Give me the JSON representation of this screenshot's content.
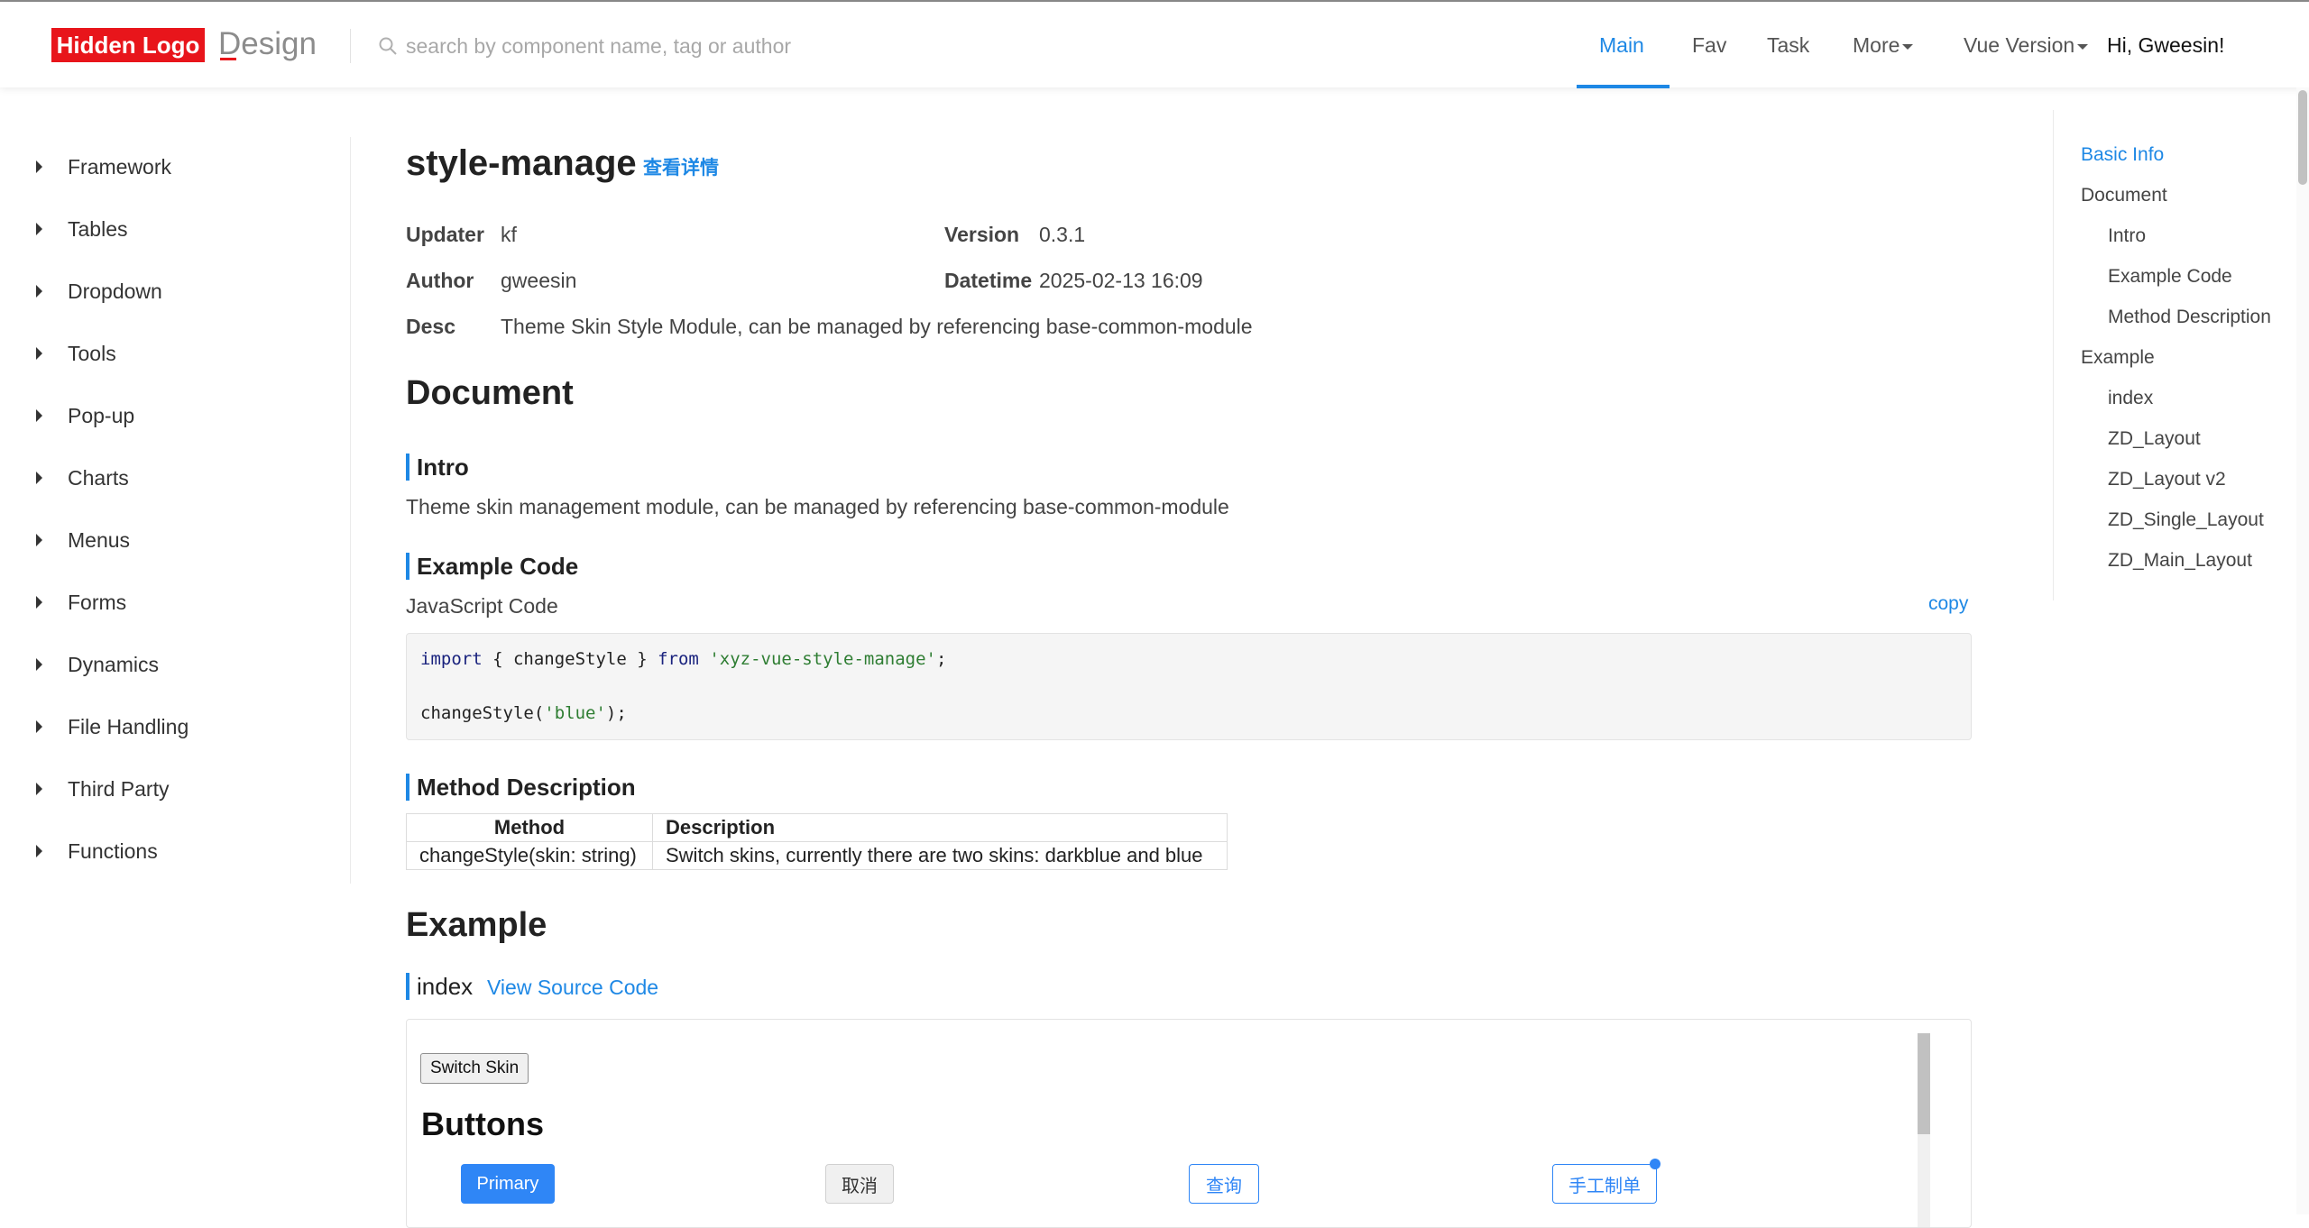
{
  "header": {
    "logo_text": "Hidden Logo",
    "brand_suffix": "Design",
    "search_placeholder": "search by component name, tag or author",
    "nav": [
      "Main",
      "Fav",
      "Task",
      "More",
      "Vue Version"
    ],
    "greeting": "Hi, Gweesin!",
    "accent_color": "#1e88e5",
    "logo_color": "#e8151b"
  },
  "sidebar": {
    "items": [
      "Framework",
      "Tables",
      "Dropdown",
      "Tools",
      "Pop-up",
      "Charts",
      "Menus",
      "Forms",
      "Dynamics",
      "File Handling",
      "Third Party",
      "Functions"
    ]
  },
  "page": {
    "title": "style-manage",
    "detail_link": "查看详情",
    "meta": {
      "updater_label": "Updater",
      "updater": "kf",
      "version_label": "Version",
      "version": "0.3.1",
      "author_label": "Author",
      "author": "gweesin",
      "datetime_label": "Datetime",
      "datetime": "2025-02-13 16:09",
      "desc_label": "Desc",
      "desc": "Theme Skin Style Module, can be managed by referencing base-common-module"
    },
    "document_heading": "Document",
    "intro_heading": "Intro",
    "intro_text": "Theme skin management module, can be managed by referencing base-common-module",
    "example_code_heading": "Example Code",
    "code_lang": "JavaScript Code",
    "copy_label": "copy",
    "code": {
      "line1_kw": "import",
      "line1_mid": " { changeStyle } ",
      "line1_from": "from",
      "line1_str": "'xyz-vue-style-manage'",
      "line1_end": ";",
      "line2_fn": "changeStyle(",
      "line2_str": "'blue'",
      "line2_end": ");"
    },
    "method_heading": "Method Description",
    "method_table": {
      "headers": [
        "Method",
        "Description"
      ],
      "rows": [
        [
          "changeStyle(skin: string)",
          "Switch skins, currently there are two skins: darkblue and blue"
        ]
      ]
    },
    "example_heading": "Example",
    "demo_name": "index",
    "view_source": "View Source Code",
    "demo": {
      "switch_skin": "Switch Skin",
      "buttons_heading": "Buttons",
      "buttons": [
        "Primary",
        "取消",
        "查询",
        "手工制单"
      ]
    }
  },
  "toc": {
    "items": [
      "Basic Info",
      "Document",
      "Intro",
      "Example Code",
      "Method Description",
      "Example",
      "index",
      "ZD_Layout",
      "ZD_Layout v2",
      "ZD_Single_Layout",
      "ZD_Main_Layout"
    ]
  }
}
